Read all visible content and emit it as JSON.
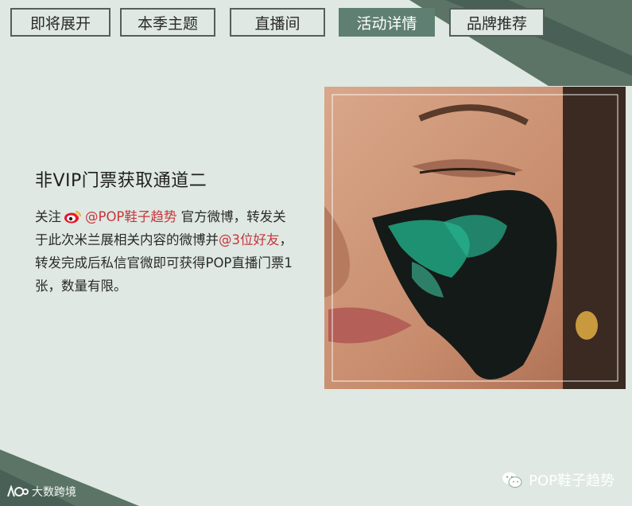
{
  "tabs": [
    {
      "label": "即将展开",
      "active": false
    },
    {
      "label": "本季主题",
      "active": false
    },
    {
      "label": "直播间",
      "active": false
    },
    {
      "label": "活动详情",
      "active": true
    },
    {
      "label": "品牌推荐",
      "active": false
    }
  ],
  "content": {
    "title": "非VIP门票获取通道二",
    "line1_prefix": "关注",
    "weibo_account": "@POP鞋子趋势",
    "line1_suffix": " 官方微博，转发关于此次米兰展相关内容的微博并",
    "mention_friends": "@3位好友",
    "line2": "，转发完成后私信官微即可获得POP直播门票1张，数量有限。"
  },
  "footer": {
    "brand": "POP鞋子趋势"
  },
  "watermark": {
    "text": "大数跨境"
  },
  "colors": {
    "background": "#dfe8e3",
    "accent_green": "#5f7f72",
    "link_red": "#c8353a"
  },
  "icons": {
    "weibo": "weibo-icon",
    "wechat": "wechat-icon"
  }
}
